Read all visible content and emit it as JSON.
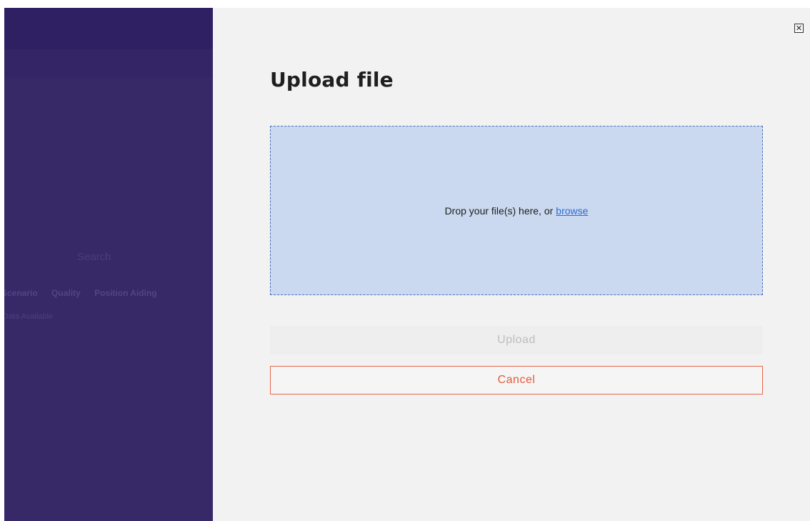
{
  "backdrop": {
    "search_placeholder": "Search",
    "columns": [
      "Scenario",
      "Quality",
      "Position Aiding"
    ],
    "empty_text": "Data Available"
  },
  "modal": {
    "title": "Upload file",
    "close_icon": "close-icon",
    "dropzone": {
      "prompt": "Drop your file(s) here, or",
      "browse_label": "browse"
    },
    "upload_label": "Upload",
    "cancel_label": "Cancel"
  },
  "colors": {
    "backdrop": "#372868",
    "dropzone_bg": "#cad9ef",
    "link": "#2e6bd6",
    "cancel": "#e25a3e"
  }
}
